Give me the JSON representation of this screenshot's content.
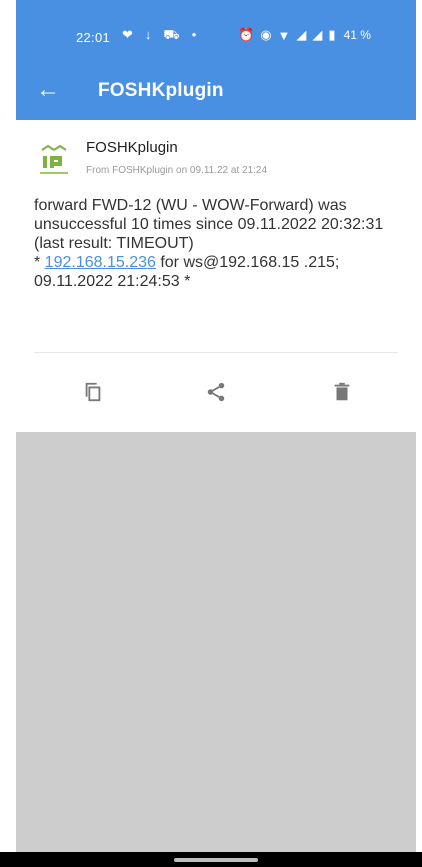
{
  "status_bar": {
    "time": "22:01",
    "battery_text": "41 %",
    "icons": [
      "heart-icon",
      "download-icon",
      "car-icon",
      "dot-icon",
      "alarm-icon",
      "eye-icon",
      "wifi-icon",
      "signal-icon",
      "signal-icon",
      "battery-icon"
    ]
  },
  "app_bar": {
    "back_icon": "arrow-left-icon",
    "title": "FOSHKplugin"
  },
  "notification": {
    "app_name": "FOSHKplugin",
    "meta": "From FOSHKplugin on 09.11.22 at 21:24",
    "message_part1": "forward FWD-12 (WU - WOW-Forward) was unsuccessful 10 times since 09.11.2022 20:32:31 (last result: TIMEOUT)\n* ",
    "link_text": "192.168.15.236",
    "message_part2": " for ws@192.168.15 .215; 09.11.2022 21:24:53 *",
    "actions": {
      "copy_icon": "copy-icon",
      "share_icon": "share-icon",
      "delete_icon": "delete-icon"
    }
  },
  "colors": {
    "accent": "#4a90e2",
    "background": "#cdcdcd",
    "card": "#ffffff"
  }
}
